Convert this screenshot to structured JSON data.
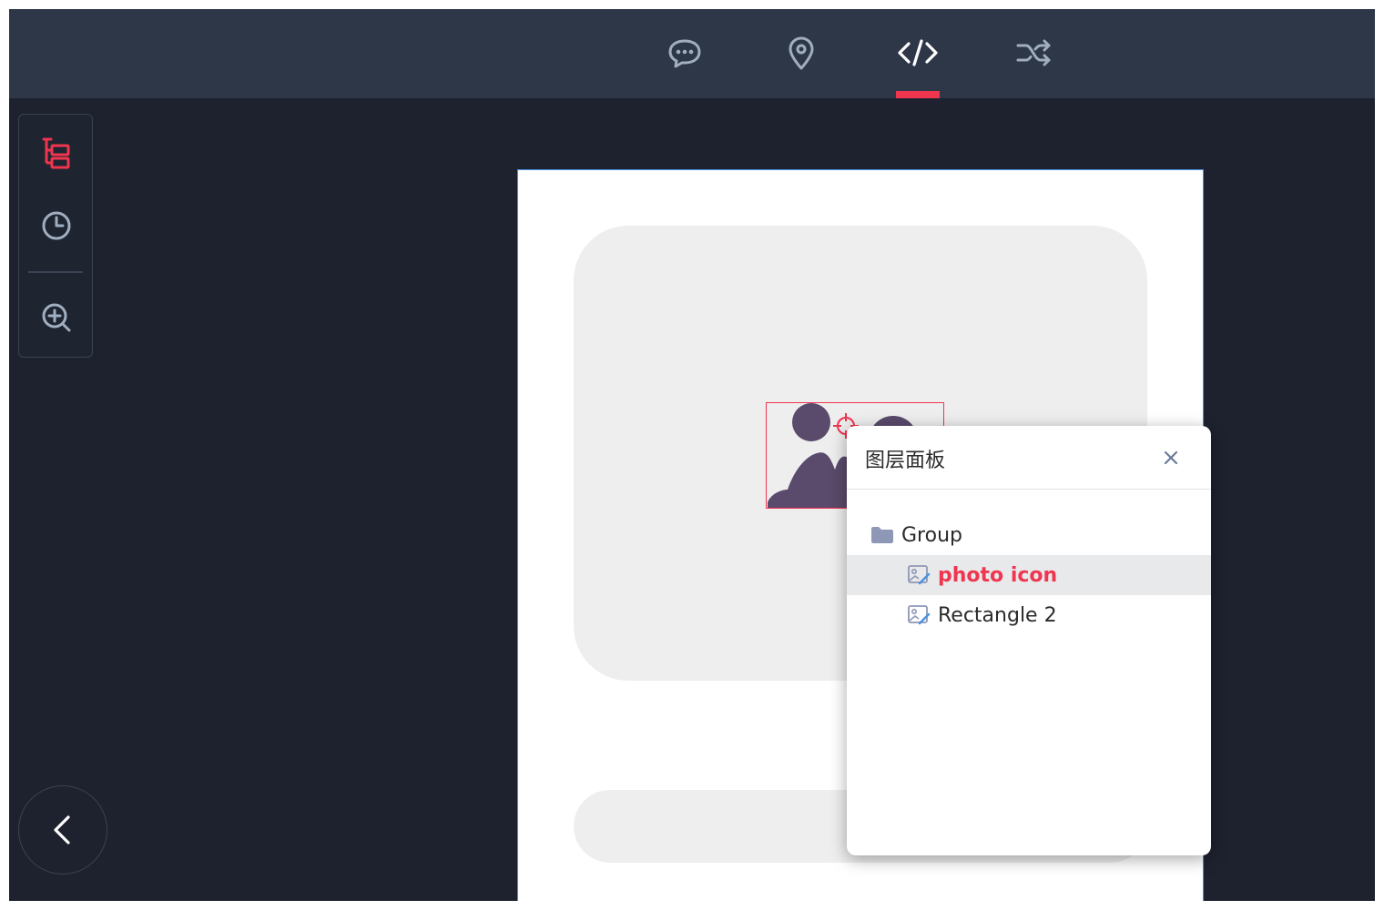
{
  "top_tabs": [
    {
      "name": "comment",
      "icon": "chat-bubble-icon",
      "active": false
    },
    {
      "name": "location",
      "icon": "map-pin-icon",
      "active": false
    },
    {
      "name": "code",
      "icon": "code-icon",
      "active": true
    },
    {
      "name": "flow",
      "icon": "shuffle-icon",
      "active": false
    }
  ],
  "toolbox": {
    "items": [
      {
        "icon": "layers-tree-icon",
        "active": true
      },
      {
        "icon": "clock-icon",
        "active": false
      },
      {
        "icon": "zoom-in-icon",
        "active": false
      }
    ]
  },
  "back_button_icon": "chevron-left-icon",
  "layer_panel": {
    "title": "图层面板",
    "close_icon": "close-icon",
    "layers": [
      {
        "label": "Group",
        "icon": "folder-icon",
        "depth": 0,
        "selected": false
      },
      {
        "label": "photo icon",
        "icon": "image-layer-icon",
        "depth": 1,
        "selected": true
      },
      {
        "label": "Rectangle 2",
        "icon": "image-layer-icon",
        "depth": 1,
        "selected": false
      }
    ]
  },
  "colors": {
    "accent": "#f0354f",
    "topbar": "#2d3748",
    "canvas_bg": "#1e222e",
    "artboard_border": "#4a90e2",
    "placeholder": "#eeeeee",
    "photo_icon_fill": "#5a4a6b"
  }
}
